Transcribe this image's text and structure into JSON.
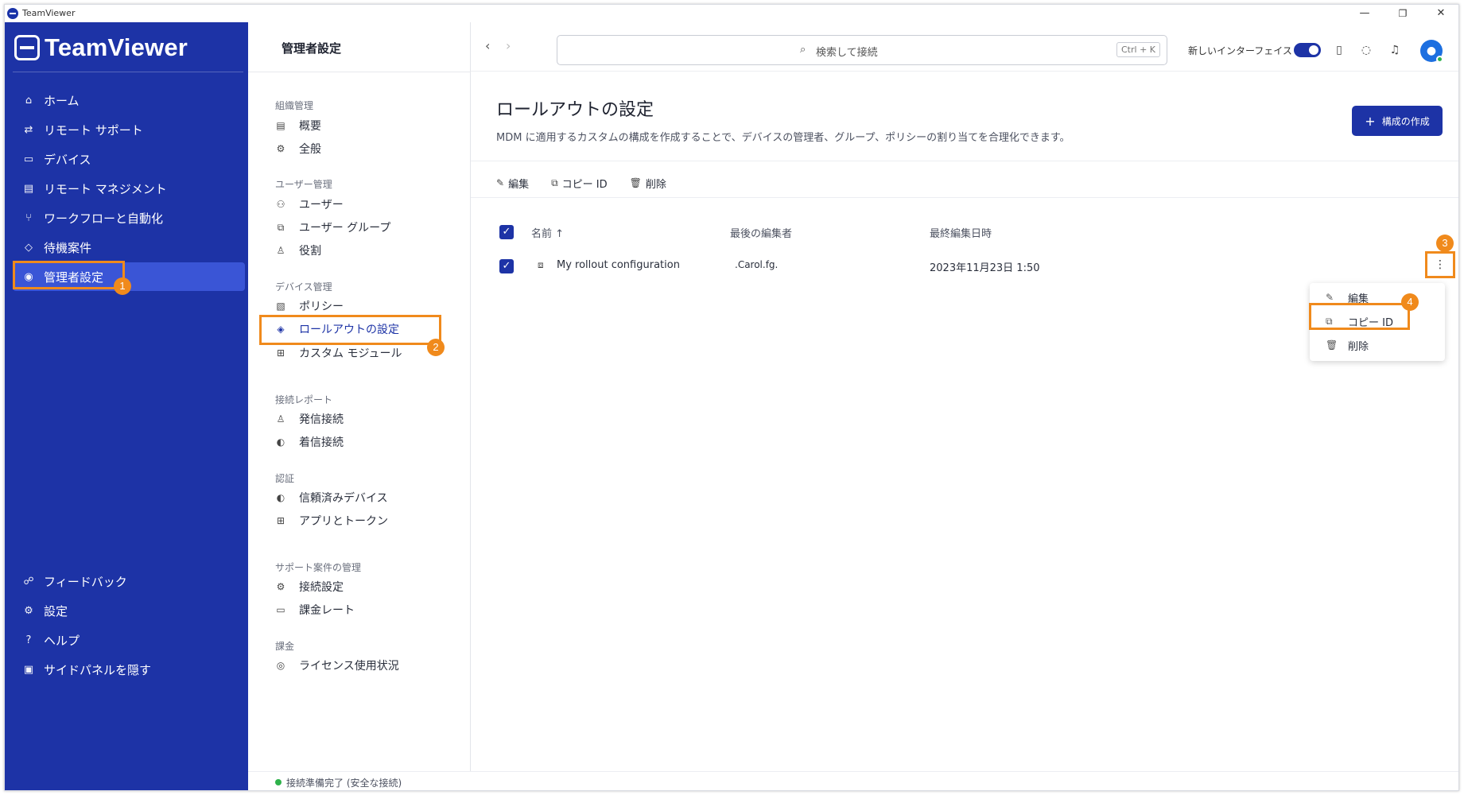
{
  "window": {
    "title": "TeamViewer",
    "minimize": "—",
    "restore": "❐",
    "close": "✕"
  },
  "sidebar": {
    "brand": "TeamViewer",
    "items": [
      {
        "label": "ホーム",
        "icon": "home-icon"
      },
      {
        "label": "リモート サポート",
        "icon": "swap-arrows-icon"
      },
      {
        "label": "デバイス",
        "icon": "device-icon"
      },
      {
        "label": "リモート マネジメント",
        "icon": "monitor-icon"
      },
      {
        "label": "ワークフローと自動化",
        "icon": "workflow-icon"
      },
      {
        "label": "待機案件",
        "icon": "tag-icon"
      },
      {
        "label": "管理者設定",
        "icon": "admin-icon",
        "active": true
      }
    ],
    "bottom_items": [
      {
        "label": "フィードバック",
        "icon": "feedback-icon"
      },
      {
        "label": "設定",
        "icon": "gear-icon"
      },
      {
        "label": "ヘルプ",
        "icon": "help-icon"
      },
      {
        "label": "サイドパネルを隠す",
        "icon": "panel-icon"
      }
    ]
  },
  "subpanel": {
    "title": "管理者設定",
    "sections": [
      {
        "heading": "組織管理",
        "items": [
          "概要",
          "全般"
        ]
      },
      {
        "heading": "ユーザー管理",
        "items": [
          "ユーザー",
          "ユーザー グループ",
          "役割"
        ]
      },
      {
        "heading": "デバイス管理",
        "items": [
          "ポリシー",
          "ロールアウトの設定",
          "カスタム モジュール"
        ]
      },
      {
        "heading": "接続レポート",
        "items": [
          "発信接続",
          "着信接続"
        ]
      },
      {
        "heading": "認証",
        "items": [
          "信頼済みデバイス",
          "アプリとトークン"
        ]
      },
      {
        "heading": "サポート案件の管理",
        "items": [
          "接続設定",
          "課金レート"
        ]
      },
      {
        "heading": "課金",
        "items": [
          "ライセンス使用状況"
        ]
      }
    ],
    "status": "接続準備完了 (安全な接続)"
  },
  "header": {
    "search_placeholder": "検索して接続",
    "search_shortcut": "Ctrl + K",
    "new_ui_label": "新しいインターフェイス",
    "new_ui_enabled": true
  },
  "main": {
    "title": "ロールアウトの設定",
    "description": "MDM に適用するカスタムの構成を作成することで、デバイスの管理者、グループ、ポリシーの割り当てを合理化できます。",
    "create_button": "構成の作成",
    "toolbar": {
      "edit": "編集",
      "copy_id": "コピー ID",
      "delete": "削除"
    },
    "table": {
      "headers": {
        "name": "名前 ↑",
        "last_editor": "最後の編集者",
        "last_edited": "最終編集日時"
      },
      "rows": [
        {
          "name": "My rollout configuration",
          "last_editor": ".Carol.fg.",
          "last_edited": "2023年11月23日 1:50"
        }
      ]
    },
    "more_button": "⋮",
    "context_menu": {
      "edit": "編集",
      "copy_id": "コピー ID",
      "delete": "削除"
    }
  },
  "annotations": {
    "badge1": "1",
    "badge2": "2",
    "badge3": "3",
    "badge4": "4"
  },
  "colors": {
    "brand": "#1d33a6",
    "highlight": "#f08a1c",
    "online": "#2fb24b"
  }
}
